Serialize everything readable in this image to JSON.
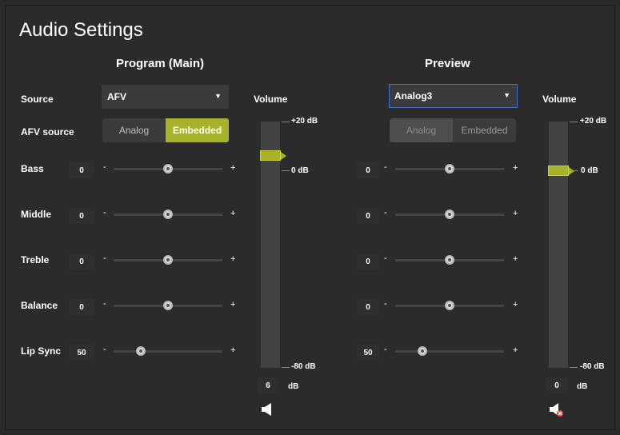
{
  "title": "Audio Settings",
  "program": {
    "heading": "Program (Main)",
    "source_label": "Source",
    "source_value": "AFV",
    "afv_label": "AFV source",
    "afv_options": [
      "Analog",
      "Embedded"
    ],
    "afv_selected": "Embedded",
    "rows": [
      {
        "label": "Bass",
        "value": "0",
        "level": 0.5
      },
      {
        "label": "Middle",
        "value": "0",
        "level": 0.5
      },
      {
        "label": "Treble",
        "value": "0",
        "level": 0.5
      },
      {
        "label": "Balance",
        "value": "0",
        "level": 0.5
      },
      {
        "label": "Lip Sync",
        "value": "50",
        "level": 0.25
      }
    ],
    "volume_label": "Volume",
    "volume_value": "6",
    "volume_unit": "dB",
    "volume_level_db": 6,
    "muted": false
  },
  "preview": {
    "heading": "Preview",
    "source_value": "Analog3",
    "afv_options": [
      "Analog",
      "Embedded"
    ],
    "afv_disabled": true,
    "rows": [
      {
        "value": "0",
        "level": 0.5
      },
      {
        "value": "0",
        "level": 0.5
      },
      {
        "value": "0",
        "level": 0.5
      },
      {
        "value": "0",
        "level": 0.5
      },
      {
        "value": "50",
        "level": 0.25
      }
    ],
    "volume_label": "Volume",
    "volume_value": "0",
    "volume_unit": "dB",
    "volume_level_db": 0,
    "muted": true
  },
  "scale": {
    "top": "+20 dB",
    "mid": "0 dB",
    "bottom": "-80 dB"
  },
  "slider_signs": {
    "minus": "-",
    "plus": "+"
  },
  "colors": {
    "accent": "#a7b42a",
    "background": "#2b2b2b",
    "focus": "#3d6fd1",
    "mute": "#e0443a"
  },
  "icons": {
    "speaker": "speaker-icon",
    "mute": "speaker-muted-icon"
  }
}
